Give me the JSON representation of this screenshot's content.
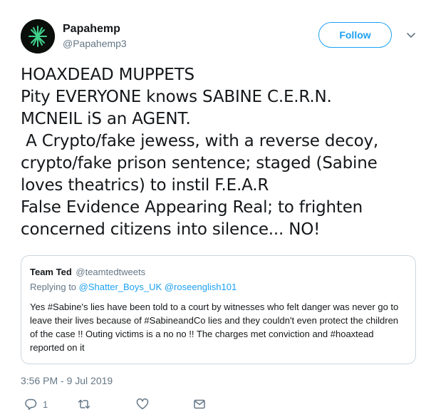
{
  "tweet": {
    "author": {
      "display_name": "Papahemp",
      "handle": "@Papahemp3"
    },
    "follow_label": "Follow",
    "text": "HOAXDEAD MUPPETS\nPity EVERYONE knows SABINE C.E.R.N.\nMCNEIL iS an AGENT.\n A Crypto/fake jewess, with a reverse decoy,\ncrypto/fake prison sentence; staged (Sabine\nloves theatrics) to instil F.E.A.R\nFalse Evidence Appearing Real; to frighten\nconcerned citizens into silence... NO!",
    "timestamp": "3:56 PM - 9 Jul 2019",
    "reply_count": "1"
  },
  "quoted": {
    "name": "Team Ted",
    "handle": "@teamtedtweets",
    "replying_prefix": "Replying to",
    "reply_to_1": "@Shatter_Boys_UK",
    "reply_to_2": "@roseenglish101",
    "text": "Yes #Sabine's lies have been told to a court by witnesses who felt danger was never go to leave their lives because of #SabineandCo lies and they couldn't even protect the children of the case !! Outing victims is a no no !! The charges met conviction and #hoaxtead reported on it"
  },
  "colors": {
    "accent": "#1da1f2",
    "muted": "#657786",
    "border": "#ccd6dd",
    "avatar_bg": "#0b0f0c",
    "avatar_glyph": "#3fd18a"
  },
  "icons": {
    "reply": "reply-icon",
    "retweet": "retweet-icon",
    "like": "heart-icon",
    "dm": "envelope-icon",
    "more": "chevron-down-icon"
  }
}
